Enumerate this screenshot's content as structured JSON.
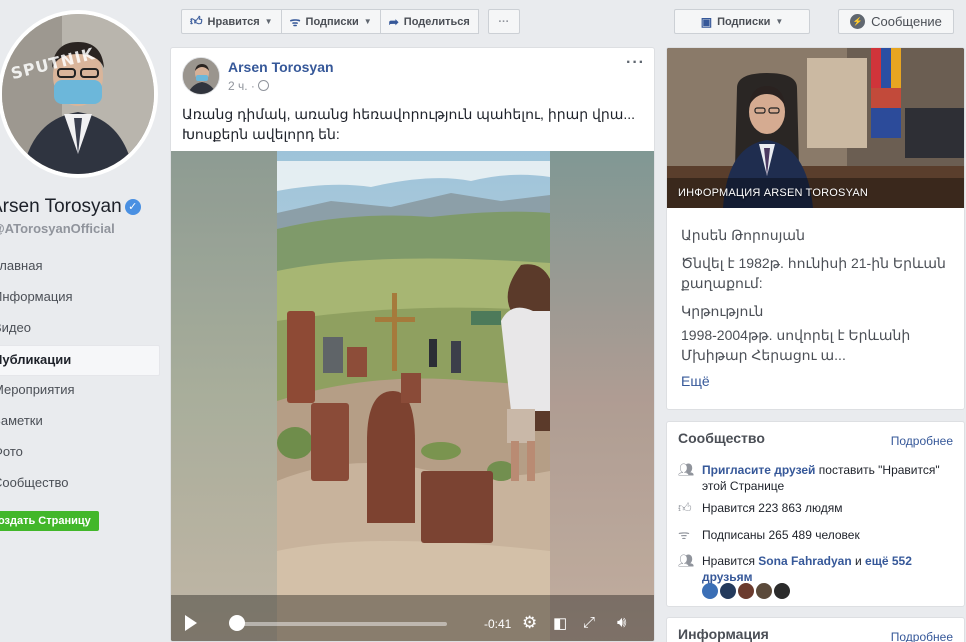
{
  "page": {
    "name": "Arsen Torosyan",
    "handle": "@ATorosyanOfficial",
    "avatar_watermark": "SPUTNIK"
  },
  "nav": {
    "items": [
      "Главная",
      "Информация",
      "Видео",
      "Публикации",
      "Мероприятия",
      "Заметки",
      "Фото",
      "Сообщество"
    ],
    "active_index": 3,
    "create_page": "Создать Страницу"
  },
  "actions": {
    "like": "Нравится",
    "follow": "Подписки",
    "share": "Поделиться",
    "more": "···",
    "subscribe": "Подписки",
    "message": "Сообщение"
  },
  "post": {
    "author": "Arsen Torosyan",
    "time": "2 ч. ·",
    "text": "Առանց դիմակ, առանց հեռավորություն պահելու, իրար վրա... Խոսքերն ավելորդ են:",
    "menu": "···",
    "video": {
      "time": "-0:41",
      "progress": 0.02
    }
  },
  "about": {
    "photo_caption": "ИНФОРМАЦИЯ ARSEN TOROSYAN",
    "name": "Արսեն Թորոսյան",
    "born": "Ծնվել է 1982թ. հունիսի 21-ին Երևան քաղաքում:",
    "education_title": "Կրթություն",
    "education": "1998-2004թթ. սովորել է Երևանի Մխիթար Հերացու ա...",
    "more": "Ещё"
  },
  "community": {
    "title": "Сообщество",
    "more": "Подробнее",
    "invite_link": "Пригласите друзей",
    "invite_rest": "поставить \"Нравится\" этой Странице",
    "likes": "Нравится 223 863 людям",
    "follows": "Подписаны 265 489 человек",
    "friends_prefix": "Нравится",
    "friends_name": "Sona Fahradyan",
    "friends_and": "и",
    "friends_more": "ещё 552 друзьям"
  },
  "info_card": {
    "title": "Информация",
    "more": "Подробнее"
  },
  "colors": {
    "link": "#365899",
    "background": "#e9ebee",
    "green": "#42b72a",
    "verified": "#4a90e2"
  },
  "icons": [
    "verified-icon",
    "like-icon",
    "rss-icon",
    "share-icon",
    "messenger-icon",
    "globe-icon",
    "play-icon",
    "gear-icon",
    "expand-icon",
    "volume-icon",
    "invite-icon",
    "thumb-icon",
    "follow-icon",
    "friends-icon"
  ]
}
